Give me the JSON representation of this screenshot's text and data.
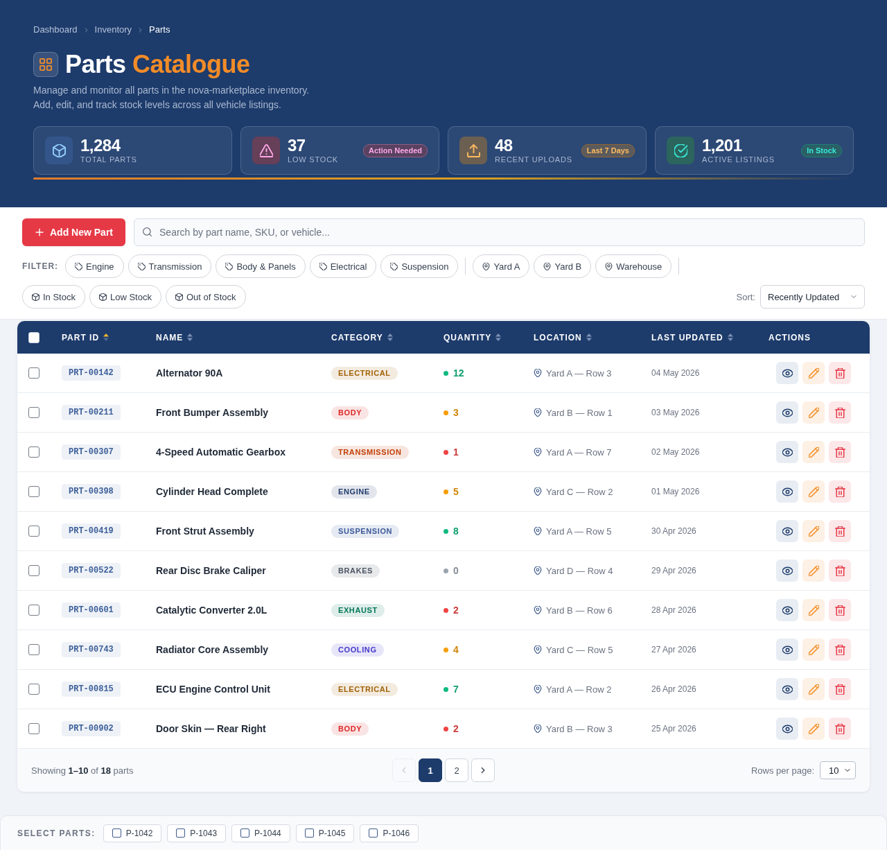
{
  "breadcrumbs": [
    {
      "label": "Dashboard",
      "current": false
    },
    {
      "label": "Inventory",
      "current": false
    },
    {
      "label": "Parts",
      "current": true
    }
  ],
  "title": {
    "text": "Parts",
    "accent": "Catalogue"
  },
  "subtitle_lines": [
    "Manage and monitor all parts in the nova-marketplace inventory.",
    "Add, edit, and track stock levels across all vehicle listings."
  ],
  "stats": [
    {
      "kind": "parts",
      "color": "#33558a",
      "value": "1,284",
      "label": "TOTAL PARTS"
    },
    {
      "kind": "warning",
      "color": "#663f58",
      "value": "37",
      "label": "LOW STOCK",
      "badge": "Action Needed"
    },
    {
      "kind": "upload",
      "color": "#6b5f52",
      "value": "48",
      "label": "RECENT UPLOADS",
      "badge": "Last 7 Days"
    },
    {
      "kind": "listings",
      "color": "#2b655e",
      "value": "1,201",
      "label": "ACTIVE LISTINGS",
      "badge": "In Stock"
    }
  ],
  "toolbar": {
    "add_button": "Add New Part",
    "search": {
      "placeholder": "Search by part name, SKU, or vehicle..."
    }
  },
  "filters": {
    "label": "FILTER:",
    "groups": [
      {
        "kind": "category",
        "chips": [
          {
            "label": "Engine",
            "selected": false
          },
          {
            "label": "Transmission",
            "selected": false
          },
          {
            "label": "Body & Panels",
            "selected": false
          },
          {
            "label": "Electrical",
            "selected": false
          },
          {
            "label": "Suspension",
            "selected": false
          }
        ]
      },
      {
        "kind": "location",
        "chips": [
          {
            "label": "Yard A",
            "selected": false
          },
          {
            "label": "Yard B",
            "selected": false
          },
          {
            "label": "Warehouse",
            "selected": false
          }
        ]
      },
      {
        "kind": "stock",
        "chips": [
          {
            "label": "In Stock",
            "selected": false
          },
          {
            "label": "Low Stock",
            "selected": false
          },
          {
            "label": "Out of Stock",
            "selected": false
          }
        ]
      }
    ]
  },
  "sort": {
    "label": "Sort:",
    "value": "Recently Updated"
  },
  "table": {
    "select_all_checked": false,
    "columns": [
      {
        "label": "PART ID",
        "sortable": true,
        "sorted": true
      },
      {
        "label": "NAME",
        "sortable": true,
        "sorted": false
      },
      {
        "label": "CATEGORY",
        "sortable": true,
        "sorted": false
      },
      {
        "label": "QUANTITY",
        "sortable": true,
        "sorted": false
      },
      {
        "label": "LOCATION",
        "sortable": true,
        "sorted": false
      },
      {
        "label": "LAST UPDATED",
        "sortable": true,
        "sorted": false
      },
      {
        "label": "ACTIONS",
        "sortable": false
      }
    ],
    "rows": [
      {
        "checked": false,
        "part_id": "PRT-00142",
        "name": "Alternator 90A",
        "category": {
          "text": "ELECTRICAL",
          "color": "#a16207"
        },
        "quantity": {
          "value": "12",
          "color": "#10b981"
        },
        "location": "Yard A — Row 3",
        "updated": "04 May 2026"
      },
      {
        "checked": false,
        "part_id": "PRT-00211",
        "name": "Front Bumper Assembly",
        "category": {
          "text": "BODY",
          "color": "#dc2626"
        },
        "quantity": {
          "value": "3",
          "color": "#f59e0b"
        },
        "location": "Yard B — Row 1",
        "updated": "03 May 2026"
      },
      {
        "checked": false,
        "part_id": "PRT-00307",
        "name": "4-Speed Automatic Gearbox",
        "category": {
          "text": "TRANSMISSION",
          "color": "#c2410c"
        },
        "quantity": {
          "value": "1",
          "color": "#ef4444"
        },
        "location": "Yard A — Row 7",
        "updated": "02 May 2026"
      },
      {
        "checked": false,
        "part_id": "PRT-00398",
        "name": "Cylinder Head Complete",
        "category": {
          "text": "ENGINE",
          "color": "#1e3a6a"
        },
        "quantity": {
          "value": "5",
          "color": "#f59e0b"
        },
        "location": "Yard C — Row 2",
        "updated": "01 May 2026"
      },
      {
        "checked": false,
        "part_id": "PRT-00419",
        "name": "Front Strut Assembly",
        "category": {
          "text": "SUSPENSION",
          "color": "#3b5a9a"
        },
        "quantity": {
          "value": "8",
          "color": "#10b981"
        },
        "location": "Yard A — Row 5",
        "updated": "30 Apr 2026"
      },
      {
        "checked": false,
        "part_id": "PRT-00522",
        "name": "Rear Disc Brake Caliper",
        "category": {
          "text": "BRAKES",
          "color": "#4b5563"
        },
        "quantity": {
          "value": "0",
          "color": "#9ca3af"
        },
        "location": "Yard D — Row 4",
        "updated": "29 Apr 2026"
      },
      {
        "checked": false,
        "part_id": "PRT-00601",
        "name": "Catalytic Converter 2.0L",
        "category": {
          "text": "EXHAUST",
          "color": "#047857"
        },
        "quantity": {
          "value": "2",
          "color": "#ef4444"
        },
        "location": "Yard B — Row 6",
        "updated": "28 Apr 2026"
      },
      {
        "checked": false,
        "part_id": "PRT-00743",
        "name": "Radiator Core Assembly",
        "category": {
          "text": "COOLING",
          "color": "#4338ca"
        },
        "quantity": {
          "value": "4",
          "color": "#f59e0b"
        },
        "location": "Yard C — Row 5",
        "updated": "27 Apr 2026"
      },
      {
        "checked": false,
        "part_id": "PRT-00815",
        "name": "ECU Engine Control Unit",
        "category": {
          "text": "ELECTRICAL",
          "color": "#a16207"
        },
        "quantity": {
          "value": "7",
          "color": "#10b981"
        },
        "location": "Yard A — Row 2",
        "updated": "26 Apr 2026"
      },
      {
        "checked": false,
        "part_id": "PRT-00902",
        "name": "Door Skin — Rear Right",
        "category": {
          "text": "BODY",
          "color": "#dc2626"
        },
        "quantity": {
          "value": "2",
          "color": "#ef4444"
        },
        "location": "Yard B — Row 3",
        "updated": "25 Apr 2026"
      }
    ]
  },
  "pagination": {
    "summary": "Showing **1–10** of **18** parts",
    "prev_disabled": true,
    "next_disabled": false,
    "pages": [
      {
        "label": "1",
        "selected": true
      },
      {
        "label": "2",
        "selected": false
      }
    ],
    "rows_label": "Rows per page:",
    "rows_value": "10"
  },
  "select_parts": {
    "label": "SELECT PARTS:",
    "items": [
      {
        "label": "P-1042",
        "checked": false
      },
      {
        "label": "P-1043",
        "checked": false
      },
      {
        "label": "P-1044",
        "checked": false
      },
      {
        "label": "P-1045",
        "checked": false
      },
      {
        "label": "P-1046",
        "checked": false
      }
    ]
  }
}
